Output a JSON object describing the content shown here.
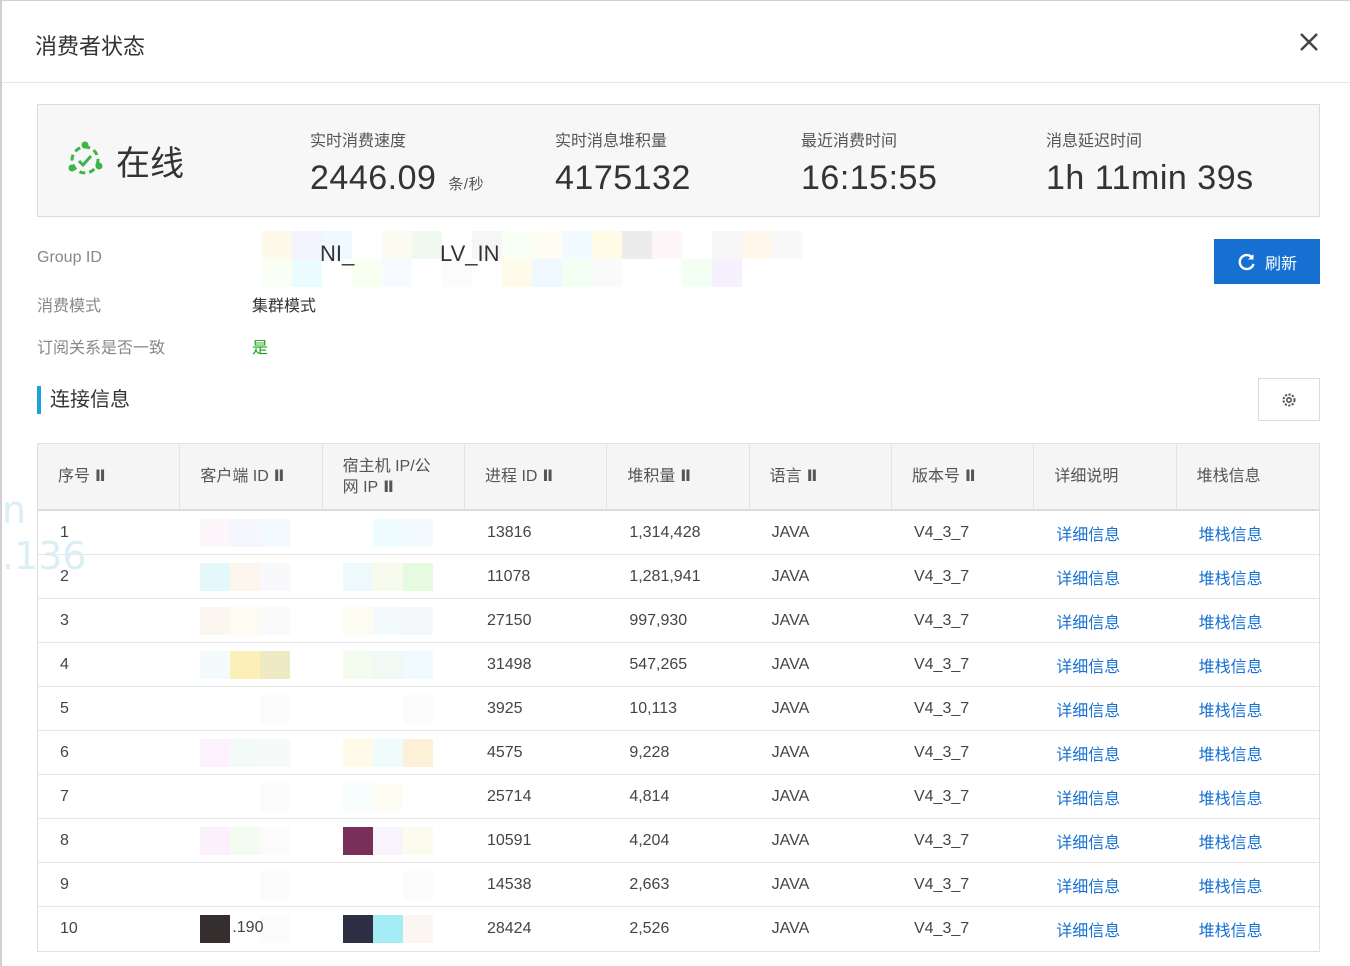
{
  "dialog": {
    "title": "消费者状态"
  },
  "stats": {
    "status": "在线",
    "speed_label": "实时消费速度",
    "speed_value": "2446.09",
    "speed_unit": "条/秒",
    "backlog_label": "实时消息堆积量",
    "backlog_value": "4175132",
    "last_consume_label": "最近消费时间",
    "last_consume_value": "16:15:55",
    "delay_label": "消息延迟时间",
    "delay_value": "1h 11min 39s"
  },
  "info": {
    "group_id_label": "Group ID",
    "group_id_fragments": [
      "NI_",
      "LV_IN"
    ],
    "mode_label": "消费模式",
    "mode_value": "集群模式",
    "subscription_label": "订阅关系是否一致",
    "subscription_value": "是"
  },
  "toolbar": {
    "refresh_label": "刷新"
  },
  "section": {
    "title": "连接信息"
  },
  "table": {
    "headers": [
      "序号",
      "客户端 ID",
      "宿主机 IP/公网 IP",
      "进程 ID",
      "堆积量",
      "语言",
      "版本号",
      "详细说明",
      "堆栈信息"
    ],
    "sort_icon": "Ⅱ",
    "detail_link": "详细信息",
    "stack_link": "堆栈信息",
    "rows": [
      {
        "no": "1",
        "pid": "13816",
        "backlog": "1,314,428",
        "lang": "JAVA",
        "version": "V4_3_7"
      },
      {
        "no": "2",
        "pid": "11078",
        "backlog": "1,281,941",
        "lang": "JAVA",
        "version": "V4_3_7"
      },
      {
        "no": "3",
        "pid": "27150",
        "backlog": "997,930",
        "lang": "JAVA",
        "version": "V4_3_7"
      },
      {
        "no": "4",
        "pid": "31498",
        "backlog": "547,265",
        "lang": "JAVA",
        "version": "V4_3_7"
      },
      {
        "no": "5",
        "pid": "3925",
        "backlog": "10,113",
        "lang": "JAVA",
        "version": "V4_3_7"
      },
      {
        "no": "6",
        "pid": "4575",
        "backlog": "9,228",
        "lang": "JAVA",
        "version": "V4_3_7"
      },
      {
        "no": "7",
        "pid": "25714",
        "backlog": "4,814",
        "lang": "JAVA",
        "version": "V4_3_7"
      },
      {
        "no": "8",
        "pid": "10591",
        "backlog": "4,204",
        "lang": "JAVA",
        "version": "V4_3_7"
      },
      {
        "no": "9",
        "pid": "14538",
        "backlog": "2,663",
        "lang": "JAVA",
        "version": "V4_3_7"
      },
      {
        "no": "10",
        "pid": "28424",
        "backlog": "2,526",
        "lang": "JAVA",
        "version": "V4_3_7",
        "client_fragment": ".190"
      }
    ]
  },
  "watermark": {
    "lines": [
      "n",
      ".136"
    ]
  },
  "colors": {
    "primary": "#1670d2",
    "accent_bar": "#1aa3d4",
    "online_green": "#3bb54a",
    "yes_green": "#1aa31a"
  },
  "icons": {
    "close": "close-icon",
    "status": "online-status-icon",
    "refresh": "refresh-icon",
    "settings": "gear-icon"
  }
}
